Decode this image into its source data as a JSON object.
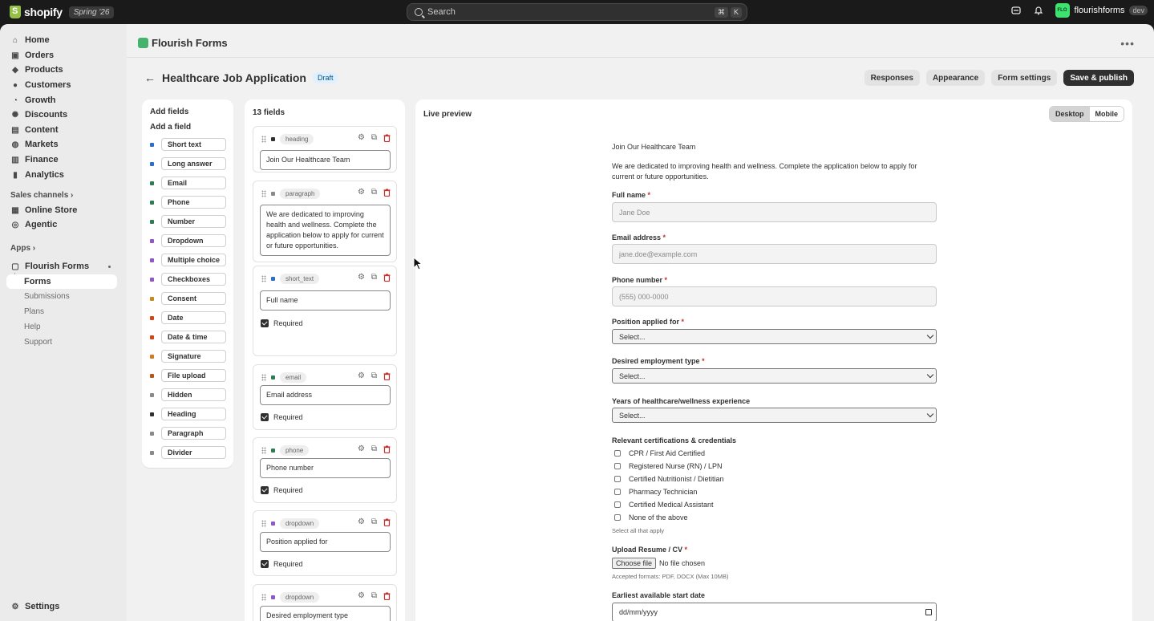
{
  "topbar": {
    "brand": "shopify",
    "edition": "Spring '26",
    "search_placeholder": "Search",
    "shortcut_keys": [
      "⌘",
      "K"
    ],
    "store_initials": "FLO",
    "store_name": "flourishforms",
    "env_badge": "dev"
  },
  "sidebar": {
    "items": [
      {
        "label": "Home",
        "icon": "home-icon",
        "glyph": "⌂"
      },
      {
        "label": "Orders",
        "icon": "orders-icon",
        "glyph": "▣"
      },
      {
        "label": "Products",
        "icon": "tag-icon",
        "glyph": "◆"
      },
      {
        "label": "Customers",
        "icon": "person-icon",
        "glyph": "●"
      },
      {
        "label": "Growth",
        "icon": "growth-icon",
        "glyph": "◔"
      },
      {
        "label": "Discounts",
        "icon": "discount-icon",
        "glyph": "✺"
      },
      {
        "label": "Content",
        "icon": "content-icon",
        "glyph": "▤"
      },
      {
        "label": "Markets",
        "icon": "globe-icon",
        "glyph": "◍"
      },
      {
        "label": "Finance",
        "icon": "bank-icon",
        "glyph": "▥"
      },
      {
        "label": "Analytics",
        "icon": "chart-icon",
        "glyph": "▮"
      }
    ],
    "sales_channels_label": "Sales channels",
    "channels": [
      {
        "label": "Online Store",
        "icon": "store-icon",
        "glyph": "▦"
      },
      {
        "label": "Agentic",
        "icon": "agent-icon",
        "glyph": "◎"
      }
    ],
    "apps_label": "Apps",
    "app_name": "Flourish Forms",
    "app_sub": {
      "active": "Forms",
      "items": [
        "Submissions",
        "Plans",
        "Help",
        "Support"
      ]
    },
    "settings_label": "Settings"
  },
  "app": {
    "title": "Flourish Forms"
  },
  "page": {
    "title": "Healthcare Job Application",
    "status": "Draft",
    "actions": {
      "responses": "Responses",
      "appearance": "Appearance",
      "form_settings": "Form settings",
      "save_publish": "Save & publish"
    }
  },
  "add_fields": {
    "heading": "Add fields",
    "subheading": "Add a field",
    "types": [
      {
        "label": "Short text",
        "color": "#2c6ecb"
      },
      {
        "label": "Long answer",
        "color": "#2c6ecb"
      },
      {
        "label": "Email",
        "color": "#2e7d4f"
      },
      {
        "label": "Phone",
        "color": "#2e7d4f"
      },
      {
        "label": "Number",
        "color": "#2e7d4f"
      },
      {
        "label": "Dropdown",
        "color": "#9157c9"
      },
      {
        "label": "Multiple choice",
        "color": "#9157c9"
      },
      {
        "label": "Checkboxes",
        "color": "#9157c9"
      },
      {
        "label": "Consent",
        "color": "#c58a1a"
      },
      {
        "label": "Date",
        "color": "#d0451b"
      },
      {
        "label": "Date & time",
        "color": "#d0451b"
      },
      {
        "label": "Signature",
        "color": "#d47b20"
      },
      {
        "label": "File upload",
        "color": "#b5561f"
      },
      {
        "label": "Hidden",
        "color": "#8a8a8a"
      },
      {
        "label": "Heading",
        "color": "#303030"
      },
      {
        "label": "Paragraph",
        "color": "#8a8a8a"
      },
      {
        "label": "Divider",
        "color": "#8a8a8a"
      }
    ]
  },
  "field_list": {
    "count_label": "13 fields",
    "required_label": "Required",
    "fields": [
      {
        "type": "heading",
        "color": "#303030",
        "value": "Join Our Healthcare Team"
      },
      {
        "type": "paragraph",
        "color": "#8a8a8a",
        "value": "We are dedicated to improving health and wellness. Complete the application below to apply for current or future opportunities."
      },
      {
        "type": "short_text",
        "color": "#2c6ecb",
        "value": "Full name"
      },
      {
        "type": "email",
        "color": "#2e7d4f",
        "value": "Email address"
      },
      {
        "type": "phone",
        "color": "#2e7d4f",
        "value": "Phone number"
      },
      {
        "type": "dropdown",
        "color": "#9157c9",
        "value": "Position applied for"
      },
      {
        "type": "dropdown",
        "color": "#9157c9",
        "value": "Desired employment type"
      }
    ]
  },
  "preview": {
    "title": "Live preview",
    "modes": [
      "Desktop",
      "Mobile"
    ],
    "active_mode": "Desktop",
    "heading": "Join Our Healthcare Team",
    "intro": "We are dedicated to improving health and wellness. Complete the application below to apply for current or future opportunities.",
    "full_name_label": "Full name",
    "full_name_placeholder": "Jane Doe",
    "email_label": "Email address",
    "email_placeholder": "jane.doe@example.com",
    "phone_label": "Phone number",
    "phone_placeholder": "(555) 000-0000",
    "position_label": "Position applied for",
    "employment_label": "Desired employment type",
    "experience_label": "Years of healthcare/wellness experience",
    "select_placeholder": "Select...",
    "certs_label": "Relevant certifications & credentials",
    "certs": [
      "CPR / First Aid Certified",
      "Registered Nurse (RN) / LPN",
      "Certified Nutritionist / Dietitian",
      "Pharmacy Technician",
      "Certified Medical Assistant",
      "None of the above"
    ],
    "certs_hint": "Select all that apply",
    "resume_label": "Upload Resume / CV",
    "choose_file": "Choose file",
    "no_file": "No file chosen",
    "resume_hint": "Accepted formats: PDF, DOCX (Max 10MB)",
    "start_date_label": "Earliest available start date",
    "date_placeholder": "dd/mm/yyyy",
    "required_mark": "*"
  }
}
